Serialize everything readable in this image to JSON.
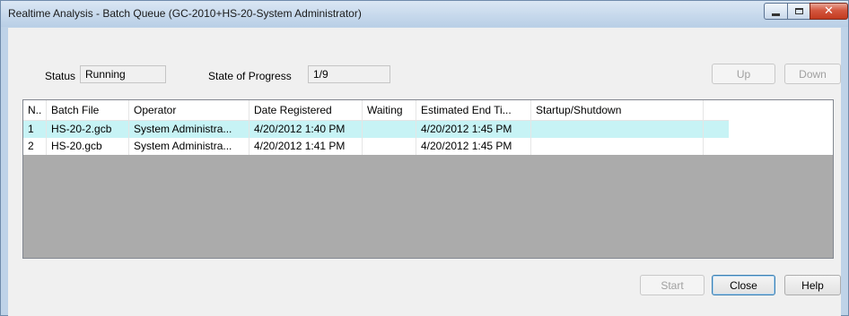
{
  "window": {
    "title": "Realtime Analysis - Batch Queue (GC-2010+HS-20-System Administrator)"
  },
  "status": {
    "status_label": "Status",
    "status_value": "Running",
    "progress_label": "State of Progress",
    "progress_value": "1/9"
  },
  "buttons": {
    "up": "Up",
    "down": "Down",
    "start": "Start",
    "close": "Close",
    "help": "Help"
  },
  "table": {
    "columns": [
      "N..",
      "Batch File",
      "Operator",
      "Date Registered",
      "Waiting",
      "Estimated End Ti...",
      "Startup/Shutdown"
    ],
    "rows": [
      [
        "1",
        "HS-20-2.gcb",
        "System Administra...",
        "4/20/2012 1:40 PM",
        "",
        "4/20/2012 1:45 PM",
        ""
      ],
      [
        "2",
        "HS-20.gcb",
        "System Administra...",
        "4/20/2012 1:41 PM",
        "",
        "4/20/2012 1:45 PM",
        ""
      ]
    ],
    "selected_row": 0
  },
  "colors": {
    "selected_row": "#c7f3f5",
    "title_bar": "#c7d9ec",
    "close_button": "#c23a1f"
  }
}
